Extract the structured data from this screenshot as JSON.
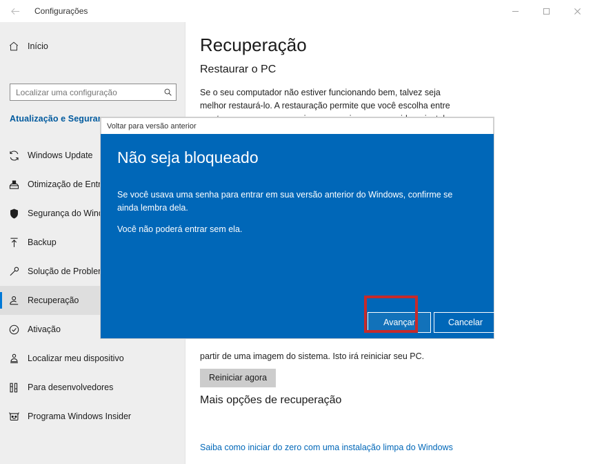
{
  "window": {
    "title": "Configurações",
    "back_icon": "back-arrow-icon",
    "minimize_label": "–",
    "maximize_label": "❐",
    "close_label": "✕"
  },
  "sidebar": {
    "home_label": "Início",
    "home_icon": "home-icon",
    "search": {
      "placeholder": "Localizar uma configuração",
      "value": "",
      "icon": "search-icon"
    },
    "section_title": "Atualização e Segurança",
    "items": [
      {
        "label": "Windows Update",
        "icon": "sync-icon",
        "selected": false
      },
      {
        "label": "Otimização de Entrega",
        "icon": "delivery-optimization-icon",
        "selected": false
      },
      {
        "label": "Segurança do Windows",
        "icon": "shield-icon",
        "selected": false
      },
      {
        "label": "Backup",
        "icon": "backup-upload-icon",
        "selected": false
      },
      {
        "label": "Solução de Problemas",
        "icon": "wrench-icon",
        "selected": false
      },
      {
        "label": "Recuperação",
        "icon": "recovery-icon",
        "selected": true
      },
      {
        "label": "Ativação",
        "icon": "check-circle-icon",
        "selected": false
      },
      {
        "label": "Localizar meu dispositivo",
        "icon": "find-device-icon",
        "selected": false
      },
      {
        "label": "Para desenvolvedores",
        "icon": "developer-tools-icon",
        "selected": false
      },
      {
        "label": "Programa Windows Insider",
        "icon": "insider-icon",
        "selected": false
      }
    ]
  },
  "main": {
    "page_title": "Recuperação",
    "restore_heading": "Restaurar o PC",
    "restore_paragraph": "Se o seu computador não estiver funcionando bem, talvez seja melhor restaurá-lo. A restauração permite que você escolha entre manter ou remover os arquivos pessoais e, em seguida, reinstala o Windows.",
    "advanced_paragraph_tail": "partir de uma imagem do sistema. Isto irá reiniciar seu PC.",
    "restart_button": "Reiniciar agora",
    "more_options_heading": "Mais opções de recuperação",
    "clean_install_link": "Saiba como iniciar do zero com uma instalação limpa do Windows"
  },
  "dialog": {
    "titlebar_text": "Voltar para versão anterior",
    "heading": "Não seja bloqueado",
    "paragraph_1": "Se você usava uma senha para entrar em sua versão anterior do Windows, confirme se ainda lembra dela.",
    "paragraph_2": "Você não poderá entrar sem ela.",
    "primary_button": "Avançar",
    "secondary_button": "Cancelar"
  },
  "annotation": {
    "highlight_color": "#c62a2a",
    "highlight_target": "Avançar"
  },
  "colors": {
    "accent": "#0067b8",
    "selection": "#0078d7",
    "link": "#0067b8",
    "sidebar_bg": "#eeeeee",
    "dialog_bg": "#0067b8",
    "primary_button_bg": "#1272ba"
  }
}
